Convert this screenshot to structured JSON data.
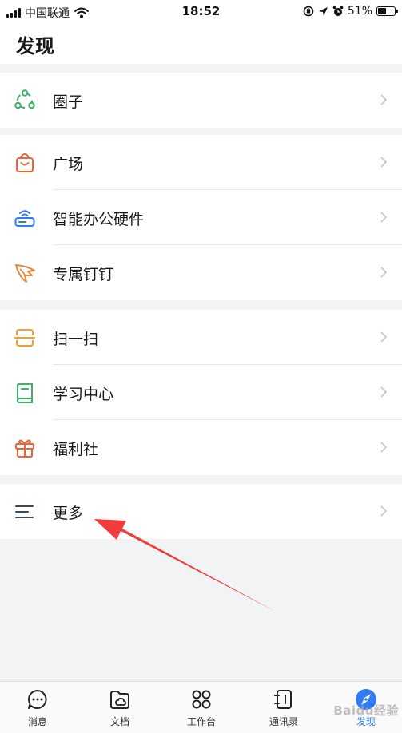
{
  "status_bar": {
    "carrier": "中国联通",
    "time": "18:52",
    "battery": "51%",
    "battery_level": 0.51
  },
  "header": {
    "title": "发现"
  },
  "groups": [
    {
      "items": [
        {
          "label": "圈子",
          "icon": "circle-nodes-icon",
          "color": "#3db06a"
        }
      ]
    },
    {
      "items": [
        {
          "label": "广场",
          "icon": "shopping-bag-icon",
          "color": "#e8663a"
        },
        {
          "label": "智能办公硬件",
          "icon": "router-wifi-icon",
          "color": "#2f7cf6"
        },
        {
          "label": "专属钉钉",
          "icon": "wing-icon",
          "color": "#e6893a"
        }
      ]
    },
    {
      "items": [
        {
          "label": "扫一扫",
          "icon": "scan-icon",
          "color": "#f0a030"
        },
        {
          "label": "学习中心",
          "icon": "book-icon",
          "color": "#3db06a"
        },
        {
          "label": "福利社",
          "icon": "gift-icon",
          "color": "#e8663a"
        }
      ]
    },
    {
      "items": [
        {
          "label": "更多",
          "icon": "menu-lines-icon",
          "color": "#3a4a5c"
        }
      ]
    }
  ],
  "tab_bar": {
    "tabs": [
      {
        "label": "消息",
        "icon": "chat-bubble-icon"
      },
      {
        "label": "文档",
        "icon": "folder-icon"
      },
      {
        "label": "工作台",
        "icon": "grid-icon"
      },
      {
        "label": "通讯录",
        "icon": "contacts-book-icon"
      },
      {
        "label": "发现",
        "icon": "compass-icon",
        "active": true
      }
    ]
  },
  "watermark": "Baidu经验",
  "colors": {
    "accent": "#2f7cf6",
    "background": "#f2f3f5",
    "arrow": "#f03c3c"
  }
}
